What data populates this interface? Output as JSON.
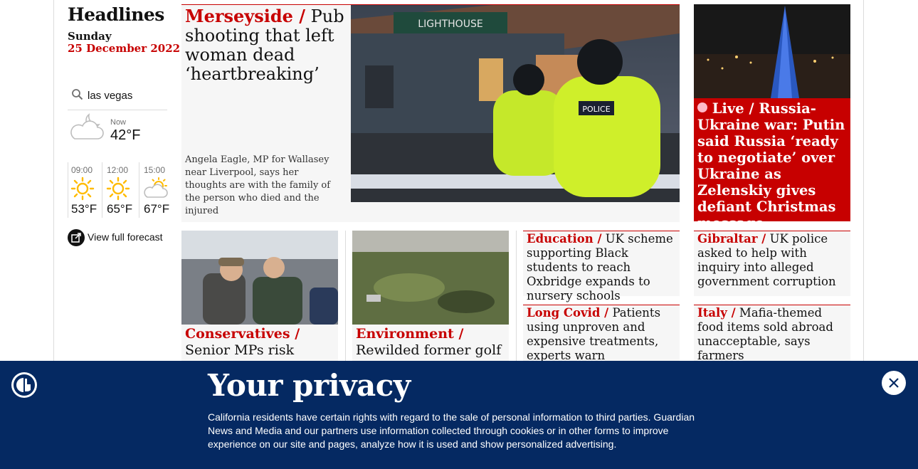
{
  "page": {
    "section_title": "Headlines",
    "day": "Sunday",
    "date": "25 December 2022"
  },
  "weather": {
    "location": "las vegas",
    "now_label": "Now",
    "now_temp": "42°F",
    "forecast": [
      {
        "time": "09:00",
        "temp": "53°F",
        "icon": "sun-icon"
      },
      {
        "time": "12:00",
        "temp": "65°F",
        "icon": "sun-icon"
      },
      {
        "time": "15:00",
        "temp": "67°F",
        "icon": "partly-cloudy-icon"
      }
    ],
    "full_forecast_label": "View full forecast"
  },
  "stories": {
    "main": {
      "kicker": "Merseyside /",
      "headline": "Pub shooting that left woman dead ‘heartbreaking’",
      "standfirst": "Angela Eagle, MP for Wallasey near Liverpool, says her thoughts are with the family of the person who died and the injured",
      "image_text": "LIGHTHOUSE",
      "police_text": "POLICE"
    },
    "live": {
      "kicker": "Live /",
      "headline": "Russia-Ukraine war: Putin said Russia ‘ready to negotiate’ over Ukraine as Zelenskiy gives defiant Christmas message"
    },
    "conservatives": {
      "kicker": "Conservatives /",
      "headline": "Senior MPs risk losing"
    },
    "environment": {
      "kicker": "Environment /",
      "headline": "Rewilded former golf"
    },
    "education": {
      "kicker": "Education /",
      "headline": "UK scheme supporting Black students to reach Oxbridge expands to nursery schools"
    },
    "long_covid": {
      "kicker": "Long Covid /",
      "headline": "Patients using unproven and expensive treatments, experts warn"
    },
    "gibraltar": {
      "kicker": "Gibraltar /",
      "headline": "UK police asked to help with inquiry into alleged government corruption"
    },
    "italy": {
      "kicker": "Italy /",
      "headline": "Mafia-themed food items sold abroad unacceptable, says farmers"
    }
  },
  "privacy": {
    "title": "Your privacy",
    "body": "California residents have certain rights with regard to the sale of personal information to third parties. Guardian News and Media and our partners use information collected through cookies or in other forms to improve experience on our site and pages, analyze how it is used and show personalized advertising."
  },
  "colors": {
    "accent_red": "#c70000",
    "brand_blue": "#052962"
  }
}
